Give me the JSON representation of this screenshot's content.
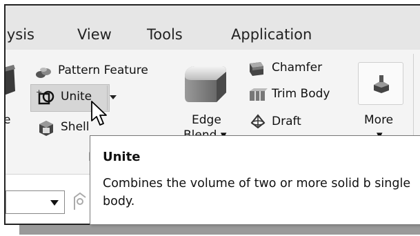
{
  "menu": {
    "items": [
      "lysis",
      "View",
      "Tools",
      "Application"
    ]
  },
  "ribbon": {
    "partial_left_label": "e",
    "pattern_feature": "Pattern Feature",
    "unite": "Unite",
    "shell_partial": "Shell",
    "edge_blend_line1": "Edge",
    "edge_blend_line2": "Blend",
    "chamfer": "Chamfer",
    "trim_body": "Trim Body",
    "draft": "Draft",
    "more": "More",
    "lower_partial": "I"
  },
  "tooltip": {
    "title": "Unite",
    "description": "Combines the volume of two or more solid b single body."
  },
  "colors": {
    "menubar_bg": "#e6e6e6",
    "ribbon_bg": "#f4f4f4",
    "highlight_bg": "#d6d6d6",
    "tooltip_bg": "#ffffff"
  }
}
